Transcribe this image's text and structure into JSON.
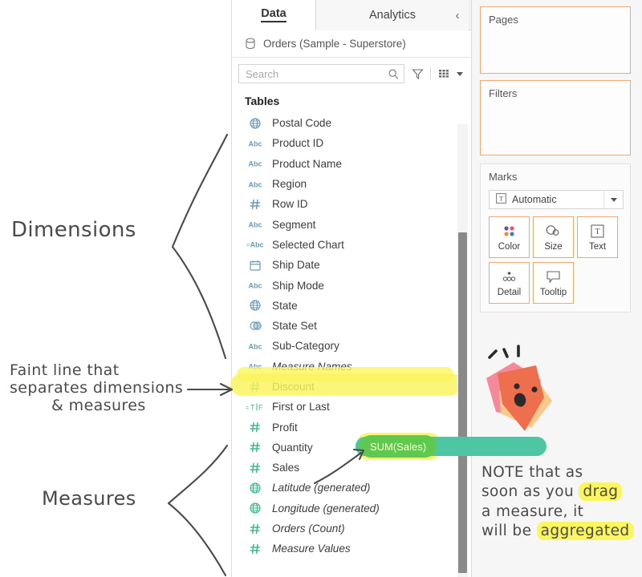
{
  "data_pane": {
    "tabs": [
      {
        "label": "Data",
        "active": true
      },
      {
        "label": "Analytics",
        "active": false
      }
    ],
    "collapse_icon": "chevron-left-icon",
    "datasource": {
      "name": "Orders (Sample - Superstore)",
      "icon": "database-icon"
    },
    "search": {
      "placeholder": "Search",
      "icon": "magnifier-icon"
    },
    "toolbar_icons": [
      "filter-funnel-icon",
      "grid-view-icon",
      "chevron-down-icon"
    ],
    "section_header": "Tables",
    "fields": [
      {
        "name": "Postal Code",
        "icon": "globe-icon",
        "type": "dimension",
        "italic": false
      },
      {
        "name": "Product ID",
        "icon": "abc-icon",
        "type": "dimension",
        "italic": false
      },
      {
        "name": "Product Name",
        "icon": "abc-icon",
        "type": "dimension",
        "italic": false
      },
      {
        "name": "Region",
        "icon": "abc-icon",
        "type": "dimension",
        "italic": false
      },
      {
        "name": "Row ID",
        "icon": "hash-icon",
        "type": "dimension",
        "italic": false
      },
      {
        "name": "Segment",
        "icon": "abc-icon",
        "type": "dimension",
        "italic": false
      },
      {
        "name": "Selected Chart",
        "icon": "calc-abc-icon",
        "type": "dimension",
        "italic": false
      },
      {
        "name": "Ship Date",
        "icon": "calendar-icon",
        "type": "dimension",
        "italic": false
      },
      {
        "name": "Ship Mode",
        "icon": "abc-icon",
        "type": "dimension",
        "italic": false
      },
      {
        "name": "State",
        "icon": "globe-icon",
        "type": "dimension",
        "italic": false
      },
      {
        "name": "State Set",
        "icon": "set-icon",
        "type": "dimension",
        "italic": false
      },
      {
        "name": "Sub-Category",
        "icon": "abc-icon",
        "type": "dimension",
        "italic": false
      },
      {
        "name": "Measure Names",
        "icon": "abc-icon",
        "type": "dimension",
        "italic": true
      },
      {
        "name": "Discount",
        "icon": "hash-icon",
        "type": "measure",
        "italic": false
      },
      {
        "name": "First or Last",
        "icon": "boolean-icon",
        "type": "measure",
        "italic": false
      },
      {
        "name": "Profit",
        "icon": "hash-icon",
        "type": "measure",
        "italic": false
      },
      {
        "name": "Quantity",
        "icon": "hash-icon",
        "type": "measure",
        "italic": false
      },
      {
        "name": "Sales",
        "icon": "hash-icon",
        "type": "measure",
        "italic": false
      },
      {
        "name": "Latitude (generated)",
        "icon": "globe-icon",
        "type": "measure",
        "italic": true
      },
      {
        "name": "Longitude (generated)",
        "icon": "globe-icon",
        "type": "measure",
        "italic": true
      },
      {
        "name": "Orders (Count)",
        "icon": "hash-icon",
        "type": "measure",
        "italic": true
      },
      {
        "name": "Measure Values",
        "icon": "hash-icon",
        "type": "measure",
        "italic": true
      }
    ]
  },
  "shelf": {
    "pages": {
      "title": "Pages"
    },
    "filters": {
      "title": "Filters"
    },
    "marks": {
      "title": "Marks",
      "mark_type": {
        "label": "Automatic",
        "icon": "text-mark-icon",
        "dropdown_icon": "chevron-down-icon"
      },
      "buttons": [
        {
          "label": "Color",
          "icon": "color-dots-icon"
        },
        {
          "label": "Size",
          "icon": "size-shapes-icon"
        },
        {
          "label": "Text",
          "icon": "text-box-icon"
        },
        {
          "label": "Detail",
          "icon": "detail-dots-icon"
        },
        {
          "label": "Tooltip",
          "icon": "tooltip-bubble-icon"
        }
      ]
    }
  },
  "dragged_pill": {
    "label": "SUM(Sales)"
  },
  "annotations": {
    "dimensions_label": "Dimensions",
    "measures_label": "Measures",
    "faint_line": {
      "line1": "Faint line that",
      "line2": "separates dimensions",
      "line3": "& measures"
    },
    "note": {
      "seg1": "NOTE that as",
      "seg2": "soon as you ",
      "hl1": "drag",
      "seg3": "a measure, it",
      "seg4": "will be ",
      "hl2": "aggregated"
    }
  },
  "colors": {
    "dimension_icon": "#6a9cb8",
    "measure_icon": "#3fba8f",
    "highlighter_yellow": "#fbf55e",
    "shelf_drop_border": "#f0a873",
    "pill_teal": "#4ec6a4",
    "pill_green": "#5fc94f",
    "sticker_orange": "#ee6f4e",
    "sticker_pink": "#f4899a",
    "sticker_tan": "#f7c98a"
  }
}
